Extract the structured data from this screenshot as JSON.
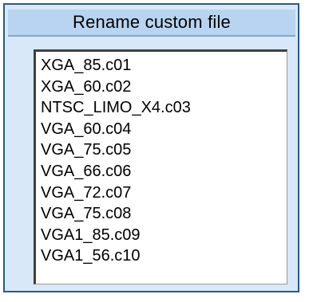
{
  "dialog": {
    "title": "Rename custom file"
  },
  "files": [
    "XGA_85.c01",
    "XGA_60.c02",
    "NTSC_LIMO_X4.c03",
    "VGA_60.c04",
    "VGA_75.c05",
    "VGA_66.c06",
    "VGA_72.c07",
    "VGA_75.c08",
    "VGA1_85.c09",
    "VGA1_56.c10"
  ],
  "colors": {
    "frame_border": "#2a5a8c",
    "frame_background": "#d8e8f8",
    "title_background": "#b8d4f0",
    "list_background": "#ffffff"
  }
}
